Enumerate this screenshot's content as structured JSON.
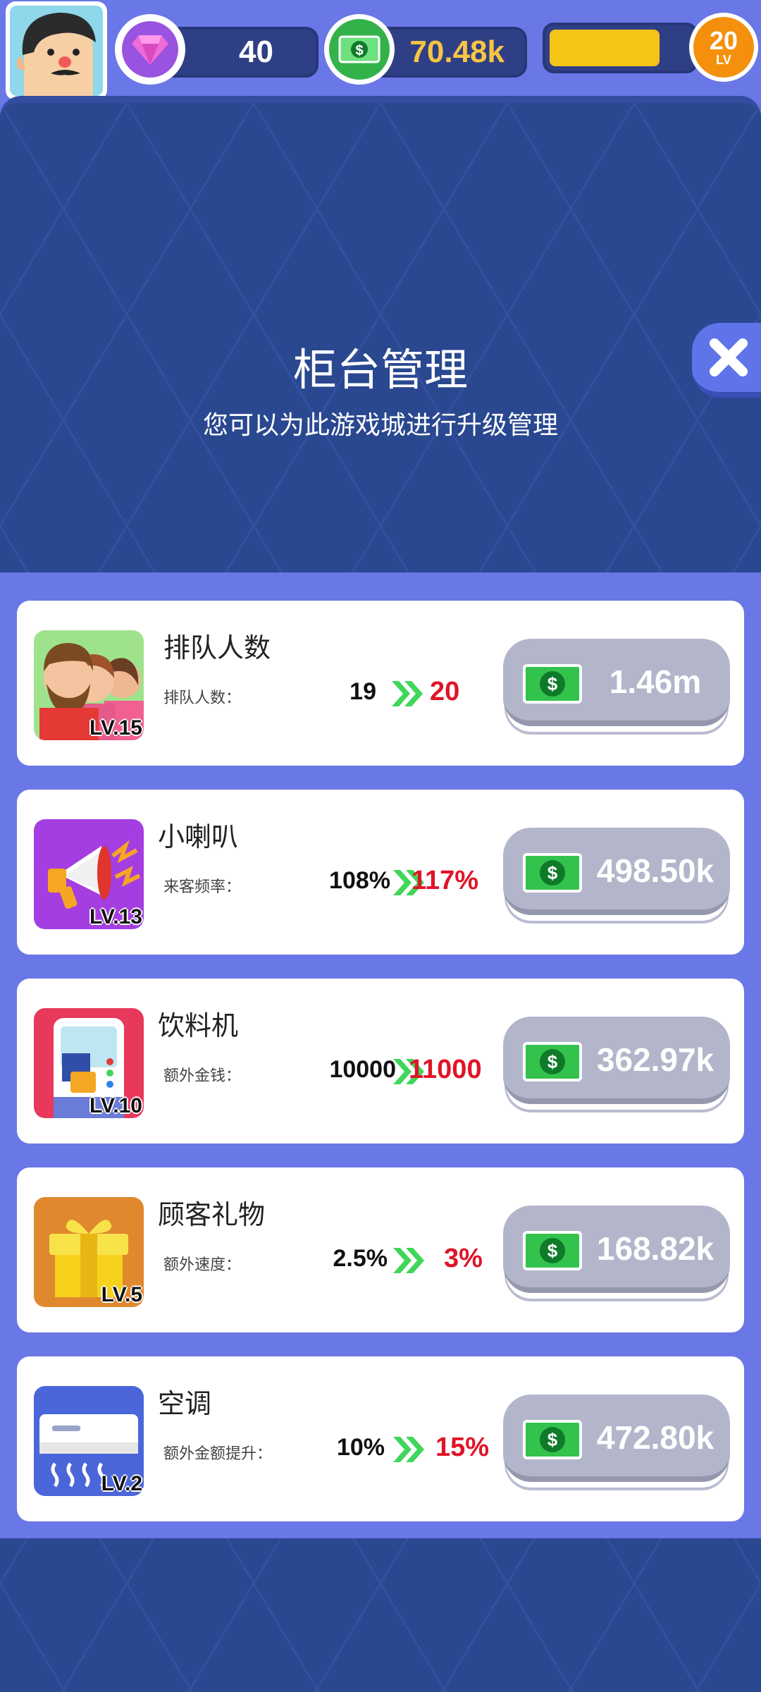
{
  "hud": {
    "gems": "40",
    "cash": "70.48k",
    "xp_progress": 0.78,
    "level_number": "20",
    "level_label": "LV"
  },
  "panel": {
    "title": "柜台管理",
    "subtitle": "您可以为此游戏城进行升级管理"
  },
  "items": [
    {
      "name": "排队人数",
      "level": "LV.15",
      "stat_label": "排队人数：",
      "stat_old": "19",
      "stat_new": "20",
      "price": "1.46m",
      "icon": "people-queue-icon"
    },
    {
      "name": "小喇叭",
      "level": "LV.13",
      "stat_label": "来客频率：",
      "stat_old": "108%",
      "stat_new": "117%",
      "price": "498.50k",
      "icon": "megaphone-icon"
    },
    {
      "name": "饮料机",
      "level": "LV.10",
      "stat_label": "额外金钱：",
      "stat_old": "10000",
      "stat_new": "11000",
      "price": "362.97k",
      "icon": "drink-machine-icon"
    },
    {
      "name": "顾客礼物",
      "level": "LV.5",
      "stat_label": "额外速度：",
      "stat_old": "2.5%",
      "stat_new": "3%",
      "price": "168.82k",
      "icon": "gift-box-icon"
    },
    {
      "name": "空调",
      "level": "LV.2",
      "stat_label": "额外金额提升：",
      "stat_old": "10%",
      "stat_new": "15%",
      "price": "472.80k",
      "icon": "air-conditioner-icon"
    }
  ],
  "colors": {
    "upgrade_value": "#e01428",
    "arrow": "#3fd65a",
    "cash_text": "#f8c443",
    "panel_bg": "#2a4890"
  }
}
